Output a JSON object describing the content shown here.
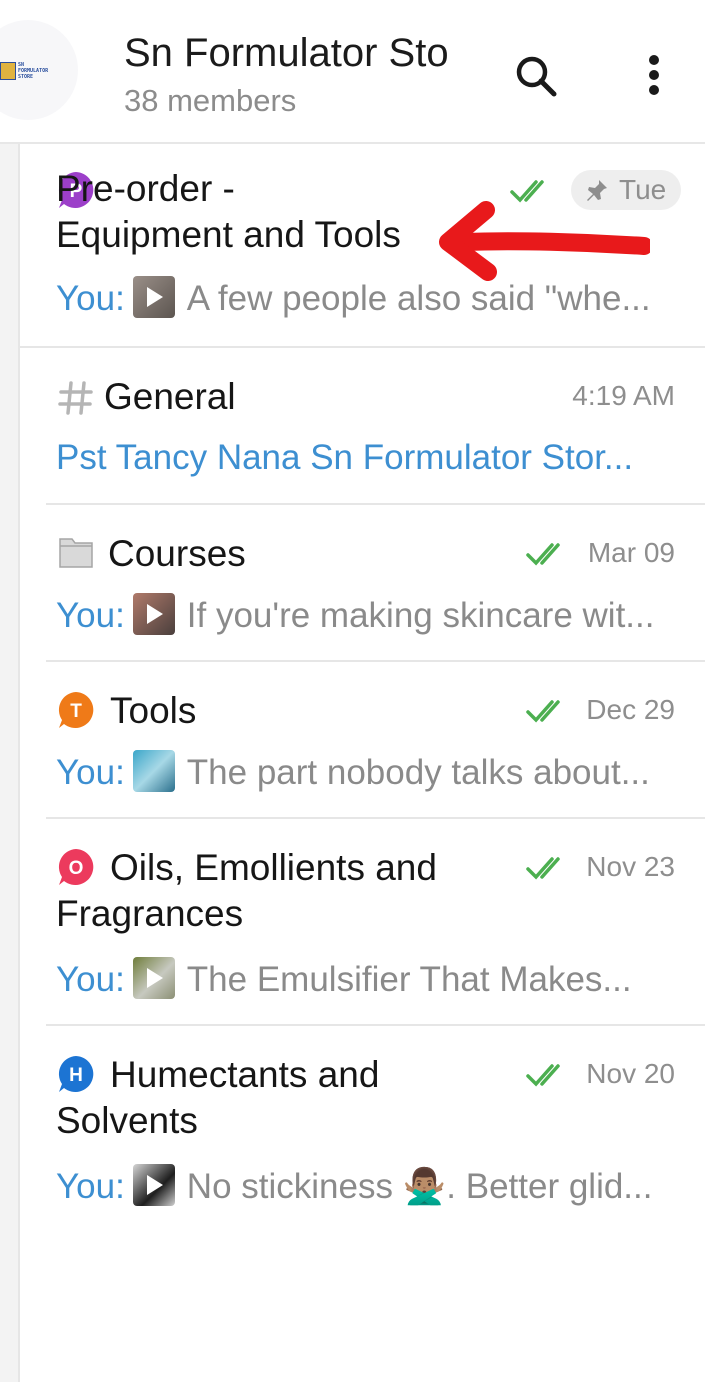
{
  "header": {
    "title": "Sn Formulator Sto",
    "members": "38 members",
    "logo_text": "SN\nFORMULATOR\nSTORE"
  },
  "topics": [
    {
      "icon_letter": "P",
      "icon_color": "#9c3fc9",
      "title_line1": "Pre-order -",
      "title_line2": "Equipment and Tools",
      "time": "Tue",
      "pinned": true,
      "read": true,
      "prefix": "You:",
      "preview": "A few people also said \"whe..."
    },
    {
      "icon_letter": "#",
      "title_line1": "General",
      "time": "4:19 AM",
      "sender": "Pst Tancy Nana Sn Formulator Stor..."
    },
    {
      "icon_letter": "",
      "title_line1": "Courses",
      "time": "Mar 09",
      "read": true,
      "prefix": "You:",
      "preview": "If you're making skincare wit..."
    },
    {
      "icon_letter": "T",
      "icon_color": "#ef7a18",
      "title_line1": "Tools",
      "time": "Dec 29",
      "read": true,
      "prefix": "You:",
      "preview": "The part nobody talks about..."
    },
    {
      "icon_letter": "O",
      "icon_color": "#ec3a5d",
      "title_line1": "Oils, Emollients and",
      "title_line2": "Fragrances",
      "time": "Nov 23",
      "read": true,
      "prefix": "You:",
      "preview": "The Emulsifier That Makes..."
    },
    {
      "icon_letter": "H",
      "icon_color": "#1c74d3",
      "title_line1": "Humectants and",
      "title_line2": "Solvents",
      "time": "Nov 20",
      "read": true,
      "prefix": "You:",
      "preview": "No stickiness 🙅🏽‍♂️. Better glid..."
    }
  ],
  "colors": {
    "accent_blue": "#3d8fd1",
    "check_green": "#4caf50",
    "annotation_red": "#e8191b"
  }
}
